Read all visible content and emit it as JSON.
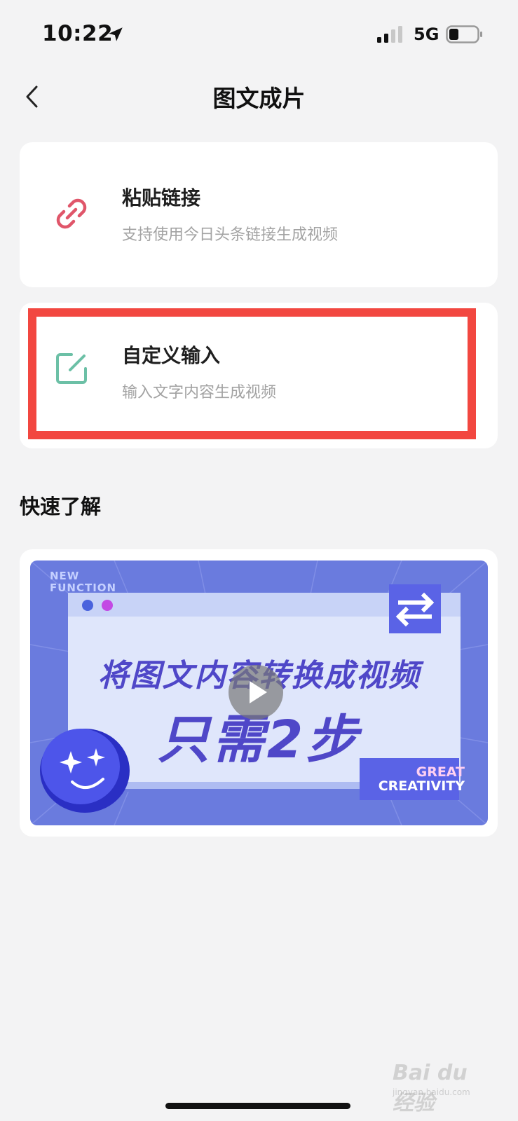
{
  "status_bar": {
    "time": "10:22",
    "network": "5G",
    "icons": [
      "location-arrow-icon",
      "signal-icon",
      "battery-icon"
    ]
  },
  "nav": {
    "title": "图文成片",
    "back_icon": "chevron-left-icon"
  },
  "options": [
    {
      "title": "粘贴链接",
      "subtitle": "支持使用今日头条链接生成视频",
      "icon": "link-icon",
      "icon_color": "#e0566a"
    },
    {
      "title": "自定义输入",
      "subtitle": "输入文字内容生成视频",
      "icon": "edit-icon",
      "icon_color": "#6cc0a6"
    }
  ],
  "highlight_color": "#f24740",
  "quick_learn": {
    "section_title": "快速了解",
    "video": {
      "tag_line1": "NEW",
      "tag_line2": "FUNCTION",
      "headline1": "将图文内容转换成视频",
      "headline2": "只需2步",
      "corner_line1": "GREAT",
      "corner_line2": "CREATIVITY",
      "play_icon": "play-icon",
      "swap_icon": "swap-arrows-icon",
      "mascot_icon": "smiley-sparkle-icon"
    }
  },
  "watermark": {
    "text": "Bai du 经验",
    "url": "jingyan.baidu.com"
  },
  "colors": {
    "background": "#f3f3f4",
    "card": "#ffffff",
    "thumbnail_blue": "#6a7bde",
    "headline": "#4f47c8"
  }
}
